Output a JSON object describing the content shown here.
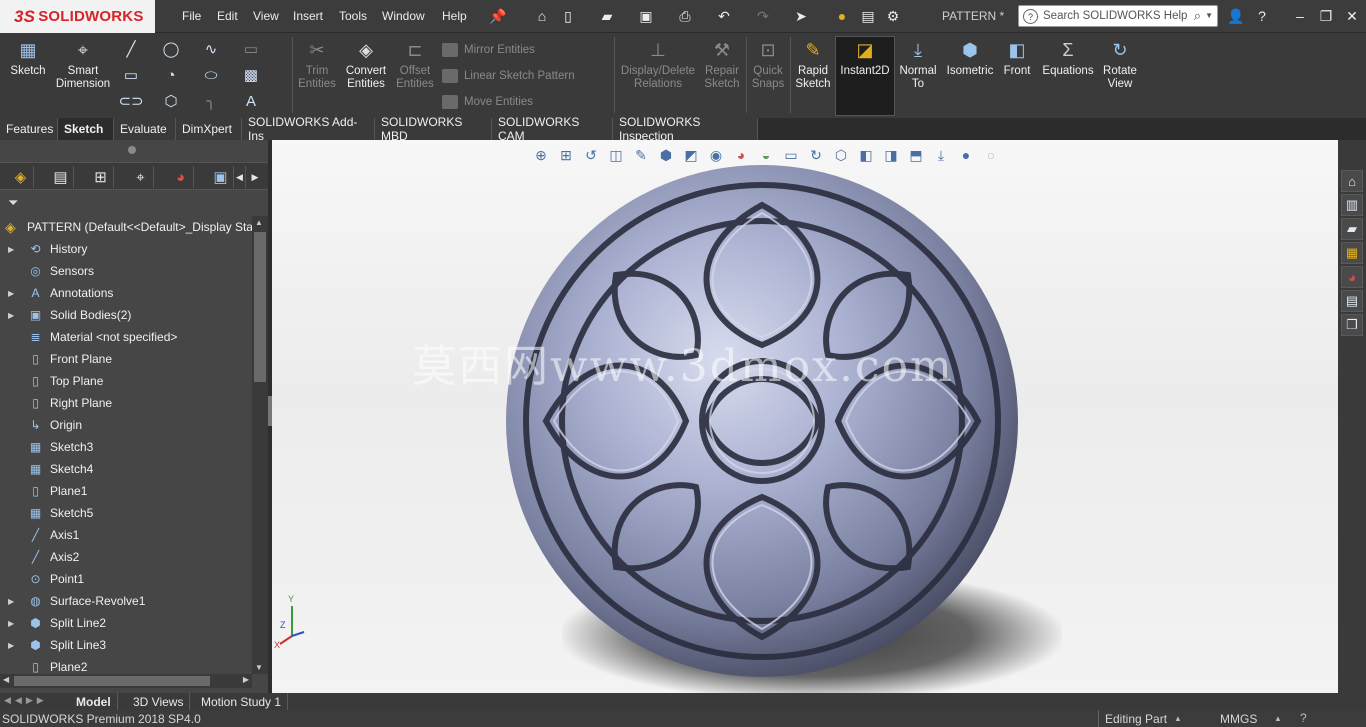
{
  "app": {
    "logo_text": "SOLIDWORKS",
    "logo_prefix": "3S",
    "document_title": "PATTERN *"
  },
  "menu": [
    "File",
    "Edit",
    "View",
    "Insert",
    "Tools",
    "Window",
    "Help"
  ],
  "search": {
    "placeholder": "Search SOLIDWORKS Help"
  },
  "command_manager": {
    "sketch": "Sketch",
    "smart_dimension": [
      "Smart",
      "Dimension"
    ],
    "trim_entities": [
      "Trim",
      "Entities"
    ],
    "convert_entities": [
      "Convert",
      "Entities"
    ],
    "offset_entities": [
      "Offset",
      "Entities"
    ],
    "mirror_entities": "Mirror Entities",
    "linear_sketch_pattern": "Linear Sketch Pattern",
    "move_entities": "Move Entities",
    "display_delete_relations": [
      "Display/Delete",
      "Relations"
    ],
    "repair_sketch": [
      "Repair",
      "Sketch"
    ],
    "quick_snaps": [
      "Quick",
      "Snaps"
    ],
    "rapid_sketch": [
      "Rapid",
      "Sketch"
    ],
    "instant2d": "Instant2D",
    "normal_to": [
      "Normal",
      "To"
    ],
    "isometric": "Isometric",
    "front": "Front",
    "equations": "Equations",
    "rotate_view": [
      "Rotate",
      "View"
    ]
  },
  "tabs": [
    "Features",
    "Sketch",
    "Evaluate",
    "DimXpert",
    "SOLIDWORKS Add-Ins",
    "SOLIDWORKS MBD",
    "SOLIDWORKS CAM",
    "SOLIDWORKS Inspection"
  ],
  "active_tab": "Sketch",
  "feature_tree": {
    "root": "PATTERN  (Default<<Default>_Display Stat",
    "items": [
      {
        "label": "History",
        "icon": "history-icon",
        "expandable": true
      },
      {
        "label": "Sensors",
        "icon": "sensors-icon",
        "expandable": false
      },
      {
        "label": "Annotations",
        "icon": "annotations-icon",
        "expandable": true
      },
      {
        "label": "Solid Bodies(2)",
        "icon": "solid-bodies-icon",
        "expandable": true
      },
      {
        "label": "Material <not specified>",
        "icon": "material-icon",
        "expandable": false
      },
      {
        "label": "Front Plane",
        "icon": "plane-icon",
        "expandable": false
      },
      {
        "label": "Top Plane",
        "icon": "plane-icon",
        "expandable": false
      },
      {
        "label": "Right Plane",
        "icon": "plane-icon",
        "expandable": false
      },
      {
        "label": "Origin",
        "icon": "origin-icon",
        "expandable": false
      },
      {
        "label": "Sketch3",
        "icon": "sketch-icon",
        "expandable": false
      },
      {
        "label": "Sketch4",
        "icon": "sketch-icon",
        "expandable": false
      },
      {
        "label": "Plane1",
        "icon": "plane-icon",
        "expandable": false
      },
      {
        "label": "Sketch5",
        "icon": "sketch-icon",
        "expandable": false
      },
      {
        "label": "Axis1",
        "icon": "axis-icon",
        "expandable": false
      },
      {
        "label": "Axis2",
        "icon": "axis-icon",
        "expandable": false
      },
      {
        "label": "Point1",
        "icon": "point-icon",
        "expandable": false
      },
      {
        "label": "Surface-Revolve1",
        "icon": "surface-revolve-icon",
        "expandable": true
      },
      {
        "label": "Split Line2",
        "icon": "split-line-icon",
        "expandable": true
      },
      {
        "label": "Split Line3",
        "icon": "split-line-icon",
        "expandable": true
      },
      {
        "label": "Plane2",
        "icon": "plane-icon",
        "expandable": false
      }
    ]
  },
  "viewport": {
    "watermark": "莫西网www.3dmox.com",
    "triad": {
      "y": "Y",
      "z": "Z",
      "x": "X"
    }
  },
  "bottom_tabs": [
    "Model",
    "3D Views",
    "Motion Study 1"
  ],
  "status": {
    "product": "SOLIDWORKS Premium 2018 SP4.0",
    "mode": "Editing Part",
    "units": "MMGS"
  },
  "colors": {
    "accent": "#4a6fa5",
    "logo_red": "#d8232a",
    "panel": "#464646",
    "toolbar": "#3a3a3a"
  }
}
